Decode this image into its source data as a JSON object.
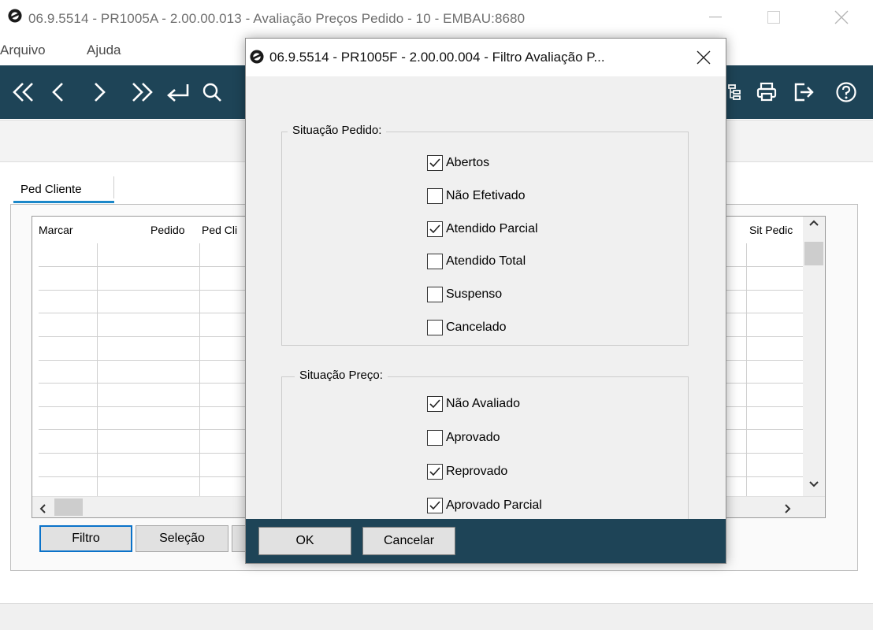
{
  "main_window": {
    "title": "06.9.5514 - PR1005A - 2.00.00.013 - Avaliação Preços Pedido - 10 - EMBAU:8680",
    "menu": [
      "Arquivo",
      "Ajuda"
    ],
    "toolbar_icons": [
      "first-icon",
      "previous-icon",
      "next-icon",
      "last-icon",
      "return-icon",
      "search-icon",
      "tree-icon",
      "print-icon",
      "exit-icon",
      "help-icon"
    ],
    "tabs": [
      {
        "label": "Ped Cliente",
        "active": true
      }
    ],
    "grid": {
      "columns": [
        "Marcar",
        "Pedido",
        "Ped Cli",
        "Sit Pedic"
      ],
      "rows": []
    },
    "buttons": {
      "filtro": "Filtro",
      "selecao": "Seleção"
    }
  },
  "dialog": {
    "title": "06.9.5514 - PR1005F - 2.00.00.004 - Filtro Avaliação P...",
    "situacao_pedido": {
      "legend": "Situação Pedido:",
      "options": [
        {
          "label": "Abertos",
          "checked": true
        },
        {
          "label": "Não Efetivado",
          "checked": false
        },
        {
          "label": "Atendido Parcial",
          "checked": true
        },
        {
          "label": "Atendido Total",
          "checked": false
        },
        {
          "label": "Suspenso",
          "checked": false
        },
        {
          "label": "Cancelado",
          "checked": false
        }
      ]
    },
    "situacao_preco": {
      "legend": "Situação Preço:",
      "options": [
        {
          "label": "Não Avaliado",
          "checked": true
        },
        {
          "label": "Aprovado",
          "checked": false
        },
        {
          "label": "Reprovado",
          "checked": true
        },
        {
          "label": "Aprovado Parcial",
          "checked": true
        }
      ]
    },
    "buttons": {
      "ok": "OK",
      "cancel": "Cancelar"
    }
  },
  "colors": {
    "toolbar": "#1e4457",
    "tab_accent": "#1b87c9",
    "dialog_footer": "#1e4457"
  }
}
